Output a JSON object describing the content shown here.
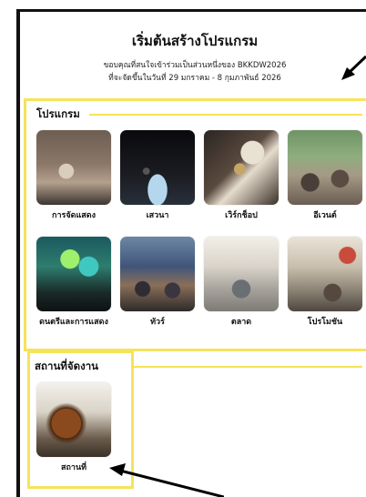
{
  "header": {
    "title": "เริ่มต้นสร้างโปรแกรม",
    "subtitle_line1": "ขอบคุณที่สนใจเข้าร่วมเป็นส่วนหนึ่งของ BKKDW2026",
    "subtitle_line2": "ที่จะจัดขึ้นในวันที่ 29 มกราคม - 8 กุมภาพันธ์ 2026"
  },
  "programs": {
    "section_title": "โปรแกรม",
    "items": [
      {
        "label": "การจัดแสดง",
        "image": "exhibition-photo"
      },
      {
        "label": "เสวนา",
        "image": "talk-photo"
      },
      {
        "label": "เวิร์กช็อป",
        "image": "workshop-photo"
      },
      {
        "label": "อีเวนต์",
        "image": "event-photo"
      },
      {
        "label": "ดนตรีและการแสดง",
        "image": "music-performance-photo"
      },
      {
        "label": "ทัวร์",
        "image": "tour-photo"
      },
      {
        "label": "ตลาด",
        "image": "market-photo"
      },
      {
        "label": "โปรโมชัน",
        "image": "promotion-photo"
      }
    ]
  },
  "venues": {
    "section_title": "สถานที่จัดงาน",
    "items": [
      {
        "label": "สถานที่",
        "image": "venue-photo"
      }
    ]
  },
  "colors": {
    "highlight": "#f6e35a",
    "frame": "#111111",
    "arrow": "#000000"
  }
}
